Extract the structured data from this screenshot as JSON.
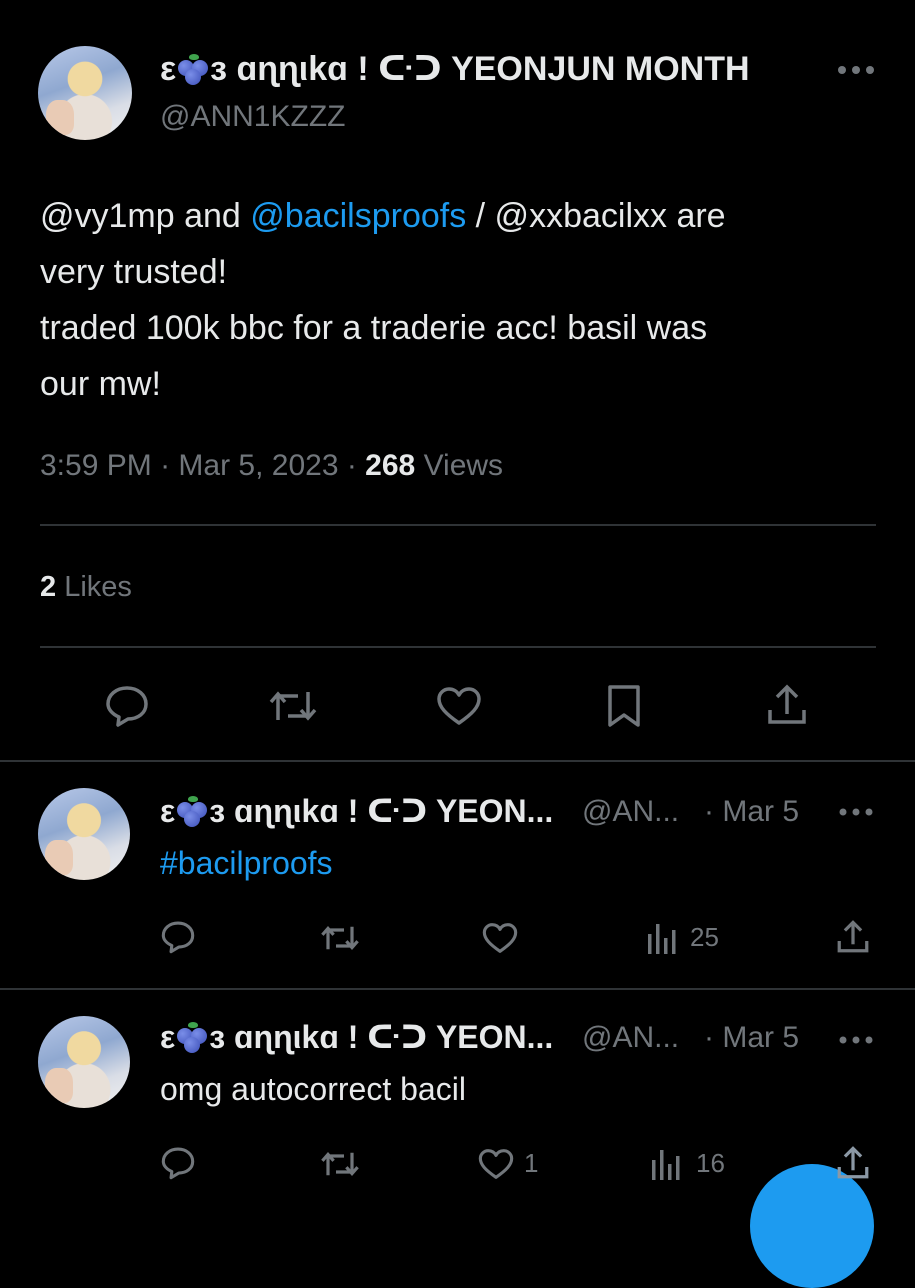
{
  "main_tweet": {
    "display_name_prefix": "ε",
    "display_name_middle": "з ɑɳɳιkɑ ! ᑢᑐ YEONJUN MONTH",
    "handle": "@ANN1KZZZ",
    "text_segments": {
      "mention_1": "@vy1mp",
      "and": " and ",
      "mention_2": "@bacilsproofs",
      "slash": " / @xxbacilxx are",
      "line_2": "very trusted!",
      "line_3": "traded 100k bbc for a traderie acc! basil was",
      "line_4": "our mw!"
    },
    "time": "3:59 PM",
    "sep1": " · ",
    "date": "Mar 5, 2023",
    "sep2": " · ",
    "views_count": "268",
    "views_label": " Views",
    "likes_count": "2",
    "likes_label": " Likes"
  },
  "replies": [
    {
      "display_name_prefix": "ε",
      "display_name": "з ɑɳɳιkɑ ! ᑢᑐ YEON...",
      "handle": "@AN...",
      "date": "· Mar 5",
      "text": "#bacilproofs",
      "like_count": "",
      "views_count": "25"
    },
    {
      "display_name_prefix": "ε",
      "display_name": "з ɑɳɳιkɑ ! ᑢᑐ YEON...",
      "handle": "@AN...",
      "date": "· Mar 5",
      "text": "omg autocorrect bacil",
      "like_count": "1",
      "views_count": "16"
    }
  ],
  "icons": {
    "reply": "reply-icon",
    "retweet": "retweet-icon",
    "like": "heart-icon",
    "bookmark": "bookmark-icon",
    "share": "share-icon",
    "views": "views-icon",
    "more": "more-icon",
    "blueberry": "blueberry-emoji"
  },
  "colors": {
    "background": "#000000",
    "text": "#e7e9ea",
    "secondary": "#71767b",
    "link": "#1d9bf0",
    "divider": "#2f3336"
  }
}
